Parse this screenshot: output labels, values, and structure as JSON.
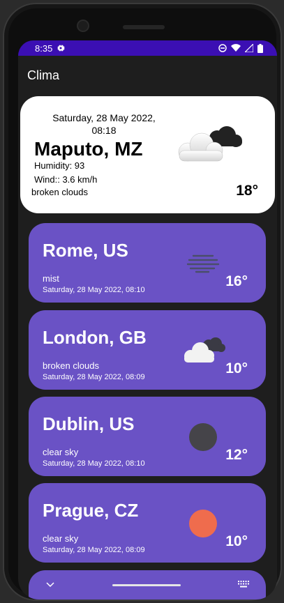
{
  "statusbar": {
    "time": "8:35"
  },
  "app": {
    "title": "Clima"
  },
  "current": {
    "date": "Saturday, 28 May 2022,",
    "time": "08:18",
    "city": "Maputo, MZ",
    "humidity": "Humidity: 93",
    "wind": "Wind:: 3.6 km/h",
    "description": "broken clouds",
    "temp": "18°",
    "icon": "broken-clouds-icon"
  },
  "cities": [
    {
      "name": "Rome, US",
      "description": "mist",
      "date": "Saturday, 28 May 2022, 08:10",
      "temp": "16°",
      "icon": "mist-icon"
    },
    {
      "name": "London, GB",
      "description": "broken clouds",
      "date": "Saturday, 28 May 2022, 08:09",
      "temp": "10°",
      "icon": "broken-clouds-icon"
    },
    {
      "name": "Dublin, US",
      "description": "clear sky",
      "date": "Saturday, 28 May 2022, 08:10",
      "temp": "12°",
      "icon": "moon-icon"
    },
    {
      "name": "Prague, CZ",
      "description": "clear sky",
      "date": "Saturday, 28 May 2022, 08:09",
      "temp": "10°",
      "icon": "sun-icon"
    }
  ],
  "colors": {
    "statusbar": "#3b0fb3",
    "card": "#6a52c5",
    "moon": "#454449",
    "sun": "#ef6c4d"
  }
}
